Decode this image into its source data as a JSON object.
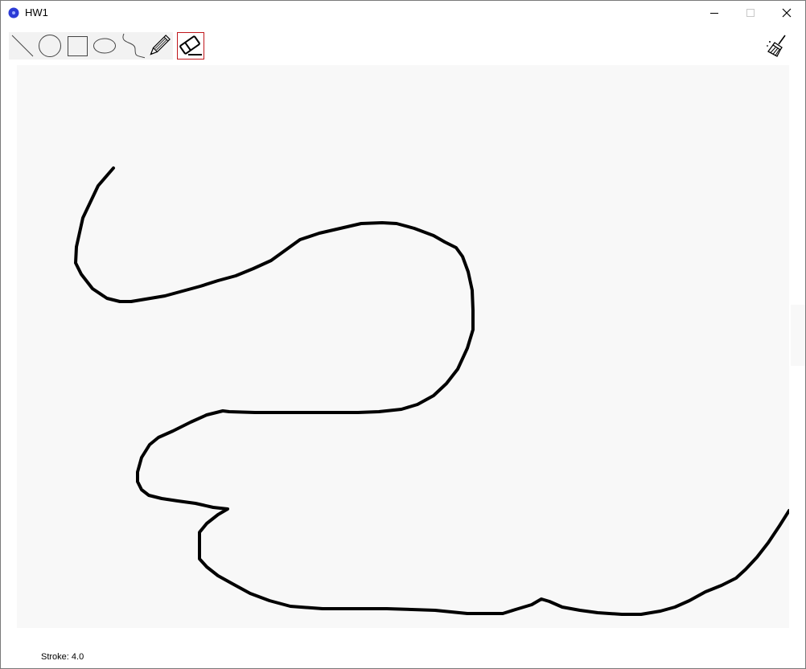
{
  "window": {
    "title": "HW1",
    "controls": [
      "minimize-icon",
      "maximize-icon",
      "close-icon"
    ]
  },
  "toolbar": {
    "tools": [
      {
        "name": "line",
        "icon": "line-icon",
        "active": false
      },
      {
        "name": "circle",
        "icon": "circle-icon",
        "active": false
      },
      {
        "name": "rectangle",
        "icon": "rectangle-icon",
        "active": false
      },
      {
        "name": "ellipse",
        "icon": "ellipse-icon",
        "active": false
      },
      {
        "name": "curve",
        "icon": "curve-icon",
        "active": false
      },
      {
        "name": "pencil",
        "icon": "pencil-icon",
        "active": false
      },
      {
        "name": "eraser",
        "icon": "eraser-icon",
        "active": true
      }
    ],
    "clear": {
      "icon": "broom-icon"
    }
  },
  "status": {
    "stroke_label": "Stroke: 4.0"
  },
  "colors": {
    "accent_active_border": "#c0161b",
    "canvas_background": "#f8f8f8",
    "stroke": "#000000",
    "app_icon": "#2b3bd6"
  }
}
